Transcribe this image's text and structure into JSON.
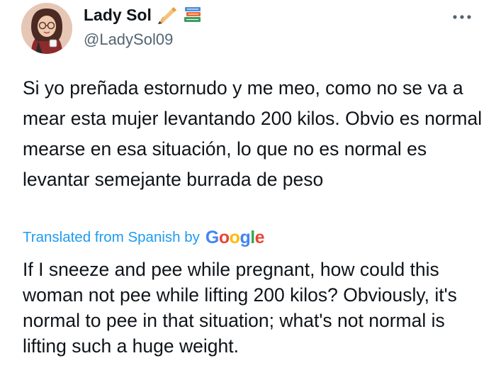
{
  "user": {
    "display_name": "Lady Sol",
    "handle": "@LadySol09",
    "name_emojis": [
      "writing-hand-icon",
      "books-icon"
    ]
  },
  "tweet": {
    "original_text": "Si yo preñada estornudo y me meo, como no se va a mear esta mujer levantando 200 kilos. Obvio es normal mearse en esa situación, lo que no es normal es levantar semejante burrada de peso",
    "translated_label": "Translated from Spanish by",
    "translation_provider": "Google",
    "translated_text": "If I sneeze and pee while pregnant, how could this woman not pee while lifting 200 kilos? Obviously, it's normal to pee in that situation; what's not normal is lifting such a huge weight."
  },
  "colors": {
    "link_blue": "#1d9bf0",
    "secondary_text": "#536471",
    "primary_text": "#0f1419",
    "google_blue": "#4285F4",
    "google_red": "#EA4335",
    "google_yellow": "#FBBC05",
    "google_green": "#34A853"
  },
  "icons": {
    "more": "more-options-icon"
  }
}
